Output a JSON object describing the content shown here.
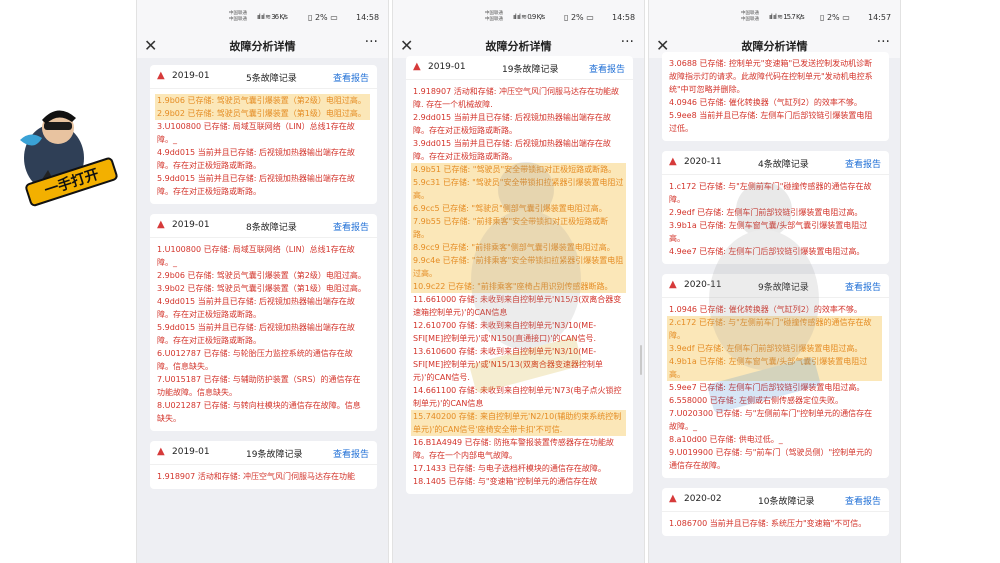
{
  "colors": {
    "accent": "#1f6fd6",
    "error": "#d3342b",
    "highlight_bg": "#fbe7b8",
    "highlight_text": "#e58d25",
    "page_bg": "#eeeff3"
  },
  "logo": {
    "text": "一手打开"
  },
  "panels": [
    {
      "status": {
        "carrier1": "中国联通",
        "carrier2": "中国联通",
        "net": "36 K/s",
        "battery": "2%",
        "time": "14:58"
      },
      "title": "故障分析详情",
      "cards": [
        {
          "year": "2019-01",
          "count": "5条故障记录",
          "view": "查看报告",
          "items": [
            {
              "text": "1.9b06 已存储: 驾驶员气囊引爆装置（第2级）电阻过高。",
              "hl": true
            },
            {
              "text": "2.9b02 已存储: 驾驶员气囊引爆装置（第1级）电阻过高。",
              "hl": true
            },
            {
              "text": "3.U100800 已存储: 局域互联网络（LIN）总线1存在故障。_",
              "hl": false
            },
            {
              "text": "4.9dd015 当前并且已存储: 后视镜加热器输出端存在故障。存在对正极短路或断路。",
              "hl": false
            },
            {
              "text": "5.9dd015 当前并且已存储: 后视镜加热器输出端存在故障。存在对正极短路或断路。",
              "hl": false
            }
          ]
        },
        {
          "year": "2019-01",
          "count": "8条故障记录",
          "view": "查看报告",
          "items": [
            {
              "text": "1.U100800 已存储: 局域互联网络（LIN）总线1存在故障。_",
              "hl": false
            },
            {
              "text": "2.9b06 已存储: 驾驶员气囊引爆装置（第2级）电阻过高。",
              "hl": false
            },
            {
              "text": "3.9b02 已存储: 驾驶员气囊引爆装置（第1级）电阻过高。",
              "hl": false
            },
            {
              "text": "4.9dd015 当前并且已存储: 后视镜加热器输出端存在故障。存在对正极短路或断路。",
              "hl": false
            },
            {
              "text": "5.9dd015 当前并且已存储: 后视镜加热器输出端存在故障。存在对正极短路或断路。",
              "hl": false
            },
            {
              "text": "6.U012787 已存储: 与轮胎压力监控系统的通信存在故障。信息缺失。",
              "hl": false
            },
            {
              "text": "7.U015187 已存储: 与辅助防护装置（SRS）的通信存在功能故障。信息缺失。",
              "hl": false
            },
            {
              "text": "8.U021287 已存储: 与转向柱模块的通信存在故障。信息缺失。",
              "hl": false
            }
          ]
        },
        {
          "year": "2019-01",
          "count": "19条故障记录",
          "view": "查看报告",
          "items": [
            {
              "text": "1.918907 活动和存储: 冲压空气风门伺服马达存在功能",
              "hl": false
            }
          ]
        }
      ]
    },
    {
      "status": {
        "carrier1": "中国联通",
        "carrier2": "中国联通",
        "net": "0.9 K/s",
        "battery": "2%",
        "time": "14:58"
      },
      "title": "故障分析详情",
      "cards": [
        {
          "year": "2019-01",
          "count": "19条故障记录",
          "view": "查看报告",
          "items": [
            {
              "text": "1.918907 活动和存储: 冲压空气风门伺服马达存在功能故障. 存在一个机械故障.",
              "hl": false
            },
            {
              "text": "2.9dd015 当前并且已存储: 后视镜加热器输出端存在故障。存在对正极短路或断路。",
              "hl": false
            },
            {
              "text": "3.9dd015 当前并且已存储: 后视镜加热器输出端存在故障。存在对正极短路或断路。",
              "hl": false
            },
            {
              "text": "4.9b51 已存储: \"驾驶员\"安全带锁扣对正极短路或断路。",
              "hl": true
            },
            {
              "text": "5.9c31 已存储: \"驾驶员\"安全带锁扣拉紧器引爆装置电阻过高。",
              "hl": true
            },
            {
              "text": "6.9cc5 已存储: \"驾驶员\"侧部气囊引爆装置电阻过高。",
              "hl": true
            },
            {
              "text": "7.9b55 已存储: \"前排乘客\"安全带锁扣对正极短路或断路。",
              "hl": true
            },
            {
              "text": "8.9cc9 已存储: \"前排乘客\"侧部气囊引爆装置电阻过高。",
              "hl": true
            },
            {
              "text": "9.9c4e 已存储: \"前排乘客\"安全带锁扣拉紧器引爆装置电阻过高。",
              "hl": true
            },
            {
              "text": "10.9c22 已存储: \"前排乘客\"座椅占用识别传感器断路。",
              "hl": true
            },
            {
              "text": "11.661000 存储: 未收到来自控制单元'N15/3(双离合器变速箱控制单元)'的CAN信息",
              "hl": false
            },
            {
              "text": "12.610700 存储: 未收到来自控制单元'N3/10(ME-SFI[ME]控制单元)'或'N150(直通接口)'的CAN信号.",
              "hl": false
            },
            {
              "text": "13.610600 存储: 未收到来自控制单元'N3/10(ME-SFI[ME]控制单元)'或'N15/13(双离合器变速器控制单元)'的CAN信号.",
              "hl": false
            },
            {
              "text": "14.661100 存储: 未收到来自控制单元'N73(电子点火锁控制单元)'的CAN信息",
              "hl": false
            },
            {
              "text": "15.740200 存储: 来自控制单元'N2/10(辅助约束系统控制单元)'的CAN信号'座椅安全带卡扣'不可信.",
              "hl": true
            },
            {
              "text": "16.B1A4949 已存储: 防拖车警报装置传感器存在功能故障。存在一个内部电气故障。",
              "hl": false
            },
            {
              "text": "17.1433 已存储: 与电子选档杆模块的通信存在故障。",
              "hl": false
            },
            {
              "text": "18.1405 已存储: 与\"变速箱\"控制单元的通信存在故",
              "hl": false
            }
          ]
        }
      ]
    },
    {
      "status": {
        "carrier1": "中国联通",
        "carrier2": "中国联通",
        "net": "15.7 K/s",
        "battery": "2%",
        "time": "14:57"
      },
      "title": "故障分析详情",
      "cards": [
        {
          "year": "",
          "count": "",
          "view": "",
          "items": [
            {
              "text": "3.0688 已存储: 控制单元\"变速箱\"已发送控制发动机诊断故障指示灯的请求。此故障代码在控制单元\"发动机电控系统\"中可忽略并删除。",
              "hl": false
            },
            {
              "text": "4.0946 已存储: 催化转换器（气缸列2）的效率不够。",
              "hl": false
            },
            {
              "text": "5.9ee8 当前并且已存储: 左侧车门后部铰链引爆装置电阻过低。",
              "hl": false
            }
          ]
        },
        {
          "year": "2020-11",
          "count": "4条故障记录",
          "view": "查看报告",
          "items": [
            {
              "text": "1.c172 已存储: 与\"左侧前车门\"碰撞传感器的通信存在故障。",
              "hl": false
            },
            {
              "text": "2.9edf 已存储: 左侧车门前部铰链引爆装置电阻过高。",
              "hl": false
            },
            {
              "text": "3.9b1a 已存储: 左侧车窗气囊/头部气囊引爆装置电阻过高。",
              "hl": false
            },
            {
              "text": "4.9ee7 已存储: 左侧车门后部铰链引爆装置电阻过高。",
              "hl": false
            }
          ]
        },
        {
          "year": "2020-11",
          "count": "9条故障记录",
          "view": "查看报告",
          "items": [
            {
              "text": "1.0946 已存储: 催化转换器（气缸列2）的效率不够。",
              "hl": false
            },
            {
              "text": "2.c172 已存储: 与\"左侧前车门\"碰撞传感器的通信存在故障。",
              "hl": true
            },
            {
              "text": "3.9edf 已存储: 左侧车门前部铰链引爆装置电阻过高。",
              "hl": true
            },
            {
              "text": "4.9b1a 已存储: 左侧车窗气囊/头部气囊引爆装置电阻过高。",
              "hl": true
            },
            {
              "text": "5.9ee7 已存储: 左侧车门后部铰链引爆装置电阻过高。",
              "hl": false
            },
            {
              "text": "6.558000 已存储: 左侧或右侧传感器定位失败。",
              "hl": false
            },
            {
              "text": "7.U020300 已存储: 与\"左侧前车门\"控制单元的通信存在故障。_",
              "hl": false
            },
            {
              "text": "8.a10d00 已存储: 供电过低。_",
              "hl": false
            },
            {
              "text": "9.U019900 已存储: 与\"前车门（驾驶员侧）\"控制单元的通信存在故障。",
              "hl": false
            }
          ]
        },
        {
          "year": "2020-02",
          "count": "10条故障记录",
          "view": "查看报告",
          "items": [
            {
              "text": "1.086700 当前并且已存储: 系统压力\"变速箱\"不可信。",
              "hl": false
            }
          ]
        }
      ]
    }
  ]
}
